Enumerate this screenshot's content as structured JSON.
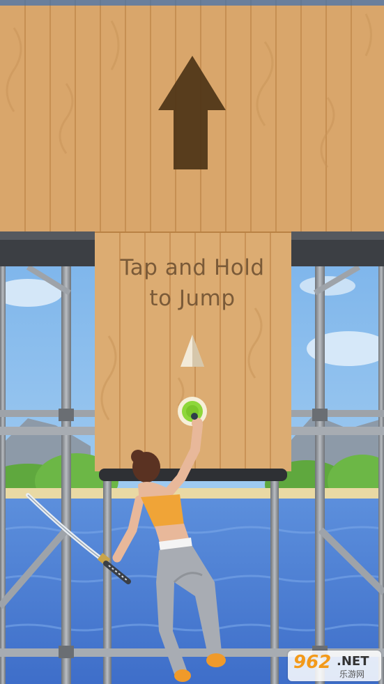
{
  "tutorial": {
    "line1": "Tap and Hold",
    "line2": "to Jump"
  },
  "watermark": {
    "number": "962",
    "domain": ".NET",
    "subtitle": "乐游网"
  },
  "icons": {
    "board_arrow": "up-arrow-icon",
    "jump_hint": "triangle-up-icon",
    "touch_point": "touch-target-icon",
    "weapon": "katana-icon"
  },
  "colors": {
    "wood": "#d9a66b",
    "wood_dark": "#c58c50",
    "arrow": "#4d3417",
    "text": "#7a5a38",
    "water": "#4d7fd1",
    "sky": "#7fb3e6",
    "touch_ring": "#8ed73a",
    "outfit_top": "#f0a437",
    "outfit_leggings": "#a8acb3",
    "shoes": "#f09a2a"
  }
}
